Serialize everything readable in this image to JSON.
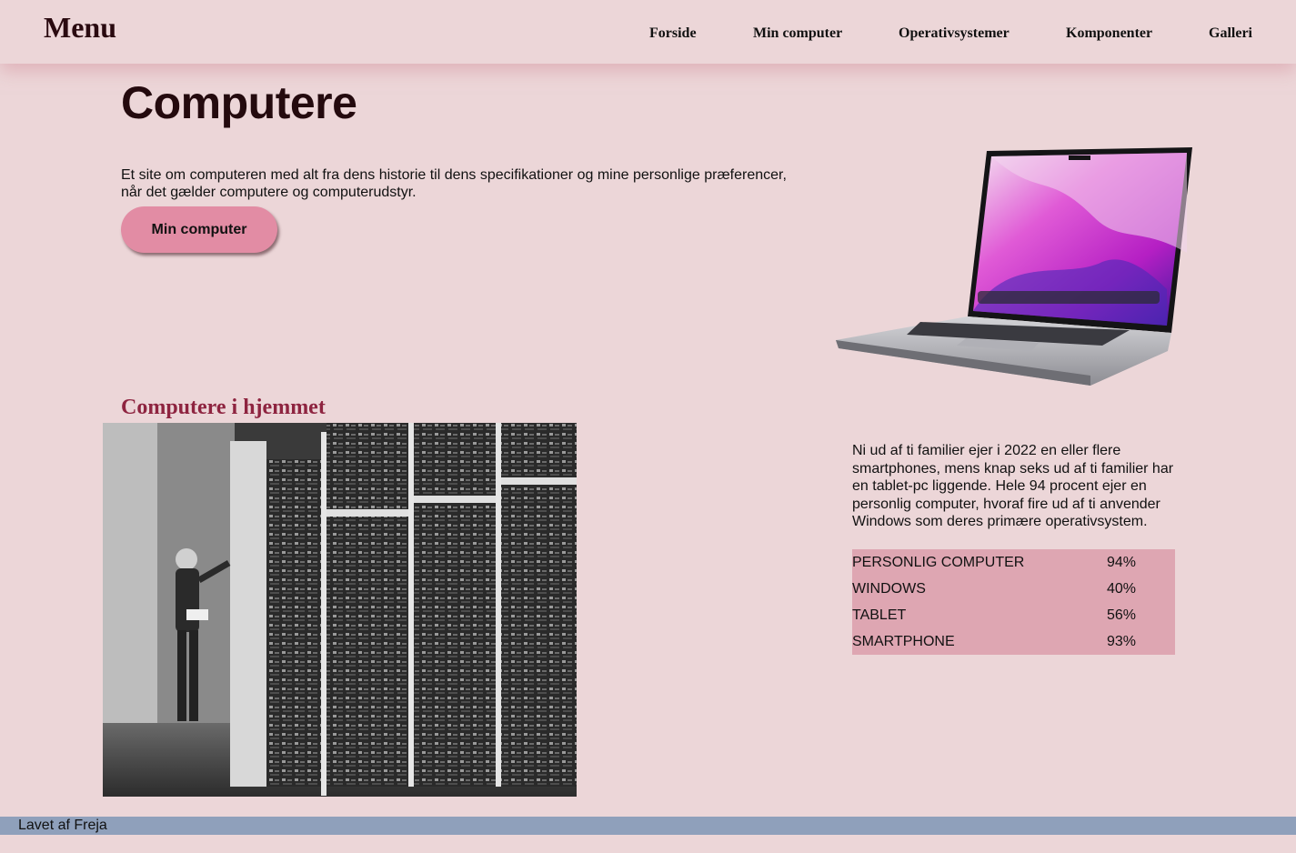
{
  "header": {
    "brand": "Menu",
    "nav": [
      {
        "label": "Forside"
      },
      {
        "label": "Min computer"
      },
      {
        "label": "Operativsystemer"
      },
      {
        "label": "Komponenter"
      },
      {
        "label": "Galleri"
      }
    ]
  },
  "hero": {
    "title": "Computere",
    "intro": "Et site om computeren med alt fra dens historie til dens specifikationer og mine personlige præferencer, når det gælder computere og computerudstyr.",
    "button_label": "Min computer"
  },
  "section": {
    "title": "Computere i hjemmet",
    "text": "Ni ud af ti familier ejer i 2022 en eller flere smartphones, mens knap seks ud af ti familier har en tablet-pc liggende. Hele 94 procent ejer en personlig computer, hvoraf fire ud af ti anvender Windows som deres primære operativsystem.",
    "stats": [
      {
        "label": "PERSONLIG COMPUTER",
        "value": "94%"
      },
      {
        "label": "WINDOWS",
        "value": "40%"
      },
      {
        "label": "TABLET",
        "value": "56%"
      },
      {
        "label": "SMARTPHONE",
        "value": "93%"
      }
    ]
  },
  "footer": {
    "text": "Lavet af Freja"
  },
  "colors": {
    "background": "#ecd6d8",
    "button": "#e28ca4",
    "section_title": "#8e2440",
    "table_background": "#dea6b2",
    "footer": "#8fa0bb"
  }
}
